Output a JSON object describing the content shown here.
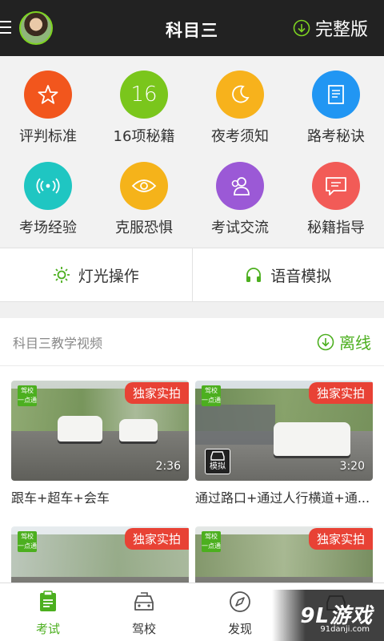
{
  "header": {
    "title": "科目三",
    "full_version_label": "完整版",
    "accent": "#4caf1f"
  },
  "grid": [
    {
      "label": "评判标准",
      "icon": "star-icon",
      "color": "#f2561d"
    },
    {
      "label": "16项秘籍",
      "icon": "number-16-icon",
      "glyph": "16",
      "color": "#7ac61c"
    },
    {
      "label": "夜考须知",
      "icon": "moon-icon",
      "color": "#f7b21c"
    },
    {
      "label": "路考秘诀",
      "icon": "document-icon",
      "color": "#2196f3"
    },
    {
      "label": "考场经验",
      "icon": "signal-icon",
      "color": "#1fc6c2"
    },
    {
      "label": "克服恐惧",
      "icon": "eye-icon",
      "color": "#f5b31a"
    },
    {
      "label": "考试交流",
      "icon": "people-icon",
      "color": "#9b59d6"
    },
    {
      "label": "秘籍指导",
      "icon": "message-icon",
      "color": "#f25b57"
    }
  ],
  "buttons": {
    "lights": "灯光操作",
    "voice": "语音模拟"
  },
  "videos": {
    "section_title": "科目三教学视频",
    "offline_label": "离线",
    "badge": "独家实拍",
    "sim_label": "模拟",
    "items": [
      {
        "caption": "跟车+超车+会车",
        "duration": "2:36"
      },
      {
        "caption": "通过路口+通过人行横道+通...",
        "duration": "3:20"
      },
      {
        "caption": "",
        "duration": ""
      },
      {
        "caption": "",
        "duration": ""
      }
    ]
  },
  "nav": [
    {
      "label": "考试",
      "icon": "exam-icon",
      "active": true
    },
    {
      "label": "驾校",
      "icon": "car-icon",
      "active": false
    },
    {
      "label": "发现",
      "icon": "compass-icon",
      "active": false
    },
    {
      "label": "",
      "icon": "car-icon",
      "active": false
    }
  ],
  "watermark": {
    "main": "9L游戏",
    "sub": "91danji.com"
  }
}
